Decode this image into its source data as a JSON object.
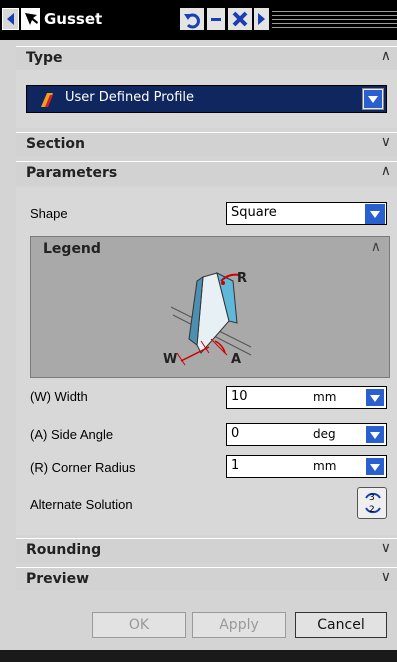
{
  "window": {
    "title": "Gusset"
  },
  "sections": {
    "type": {
      "label": "Type",
      "expanded": true,
      "dropdown_value": "User Defined Profile"
    },
    "section": {
      "label": "Section",
      "expanded": false
    },
    "parameters": {
      "label": "Parameters",
      "expanded": true,
      "shape_label": "Shape",
      "shape_value": "Square",
      "legend": {
        "title": "Legend",
        "labels": {
          "r": "R",
          "w": "W",
          "a": "A"
        }
      },
      "fields": [
        {
          "label": "(W) Width",
          "value": "10",
          "unit": "mm"
        },
        {
          "label": "(A) Side Angle",
          "value": "0",
          "unit": "deg"
        },
        {
          "label": "(R) Corner Radius",
          "value": "1",
          "unit": "mm"
        }
      ],
      "alternate_solution_label": "Alternate Solution"
    },
    "rounding": {
      "label": "Rounding",
      "expanded": false
    },
    "preview": {
      "label": "Preview",
      "expanded": false
    }
  },
  "buttons": {
    "ok": "OK",
    "apply": "Apply",
    "cancel": "Cancel"
  },
  "icons": {
    "back": "chevron-left-icon",
    "select": "arrow-select-icon",
    "reset": "undo-icon",
    "minimize": "minus-icon",
    "close": "close-icon",
    "forward": "chevron-right-icon",
    "alternate": "cycle-icon"
  },
  "colors": {
    "accent": "#10265e",
    "arrow_blue": "#2a5fd0",
    "legend_red": "#cc0000"
  }
}
